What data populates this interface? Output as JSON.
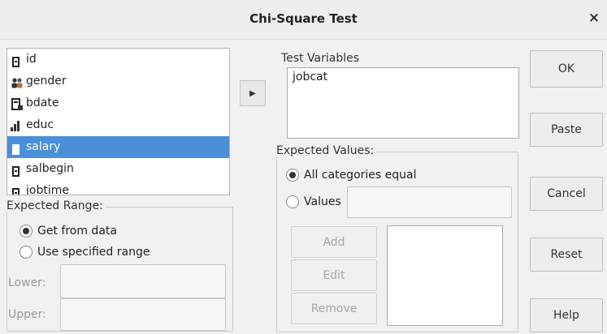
{
  "dialog": {
    "title": "Chi-Square Test",
    "close_glyph": "×"
  },
  "variables": [
    {
      "name": "id",
      "icon": "scale-icon"
    },
    {
      "name": "gender",
      "icon": "nominal-icon"
    },
    {
      "name": "bdate",
      "icon": "date-icon"
    },
    {
      "name": "educ",
      "icon": "ordinal-icon"
    },
    {
      "name": "salary",
      "icon": "scale-icon",
      "selected": true
    },
    {
      "name": "salbegin",
      "icon": "scale-icon"
    },
    {
      "name": "jobtime",
      "icon": "scale-icon"
    }
  ],
  "move_button": {
    "glyph": "▶"
  },
  "test_variables": {
    "label": "Test Variables",
    "items": [
      "jobcat"
    ]
  },
  "expected_range": {
    "label": "Expected Range:",
    "opt_data": "Get from data",
    "opt_specified": "Use specified range",
    "lower_label": "Lower:",
    "upper_label": "Upper:",
    "selected": "data"
  },
  "expected_values": {
    "label": "Expected Values:",
    "opt_equal": "All categories equal",
    "opt_values": "Values",
    "selected": "equal",
    "add": "Add",
    "edit": "Edit",
    "remove": "Remove"
  },
  "buttons": {
    "ok": "OK",
    "paste": "Paste",
    "cancel": "Cancel",
    "reset": "Reset",
    "help": "Help"
  }
}
